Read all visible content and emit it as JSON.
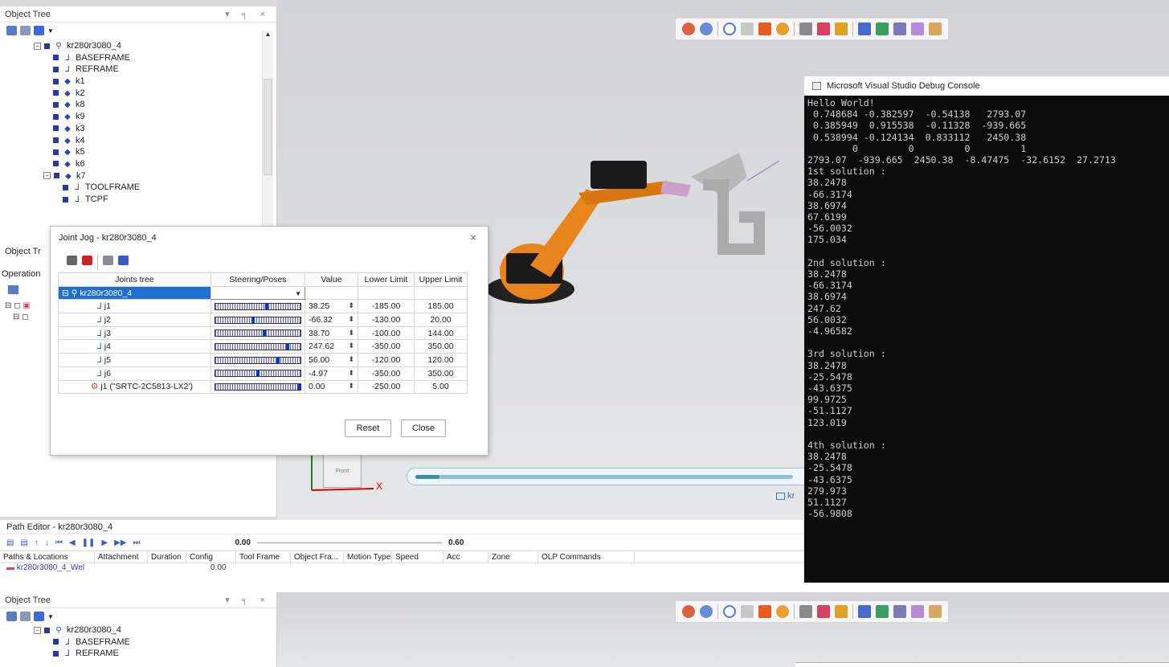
{
  "object_tree": {
    "title": "Object Tree",
    "controls": "▾ ╕ ×",
    "items": [
      {
        "label": "kr280r3080_4",
        "level": 0,
        "icon": "robot-icon"
      },
      {
        "label": "BASEFRAME",
        "level": 1,
        "icon": "frame-icon"
      },
      {
        "label": "REFRAME",
        "level": 1,
        "icon": "frame-icon"
      },
      {
        "label": "k1",
        "level": 1,
        "icon": "kinematic-icon"
      },
      {
        "label": "k2",
        "level": 1,
        "icon": "kinematic-icon"
      },
      {
        "label": "k8",
        "level": 1,
        "icon": "kinematic-icon"
      },
      {
        "label": "k9",
        "level": 1,
        "icon": "kinematic-icon"
      },
      {
        "label": "k3",
        "level": 1,
        "icon": "kinematic-icon"
      },
      {
        "label": "k4",
        "level": 1,
        "icon": "kinematic-icon"
      },
      {
        "label": "k5",
        "level": 1,
        "icon": "kinematic-icon"
      },
      {
        "label": "k6",
        "level": 1,
        "icon": "kinematic-icon"
      },
      {
        "label": "k7",
        "level": 1,
        "icon": "kinematic-icon"
      },
      {
        "label": "TOOLFRAME",
        "level": 2,
        "icon": "frame-icon"
      },
      {
        "label": "TCPF",
        "level": 2,
        "icon": "frame-icon"
      }
    ]
  },
  "side_tabs": {
    "object_tree_short": "Object Tr",
    "operation_short": "Operation"
  },
  "joint_jog": {
    "title": "Joint Jog - kr280r3080_4",
    "close": "×",
    "headers": [
      "Joints tree",
      "Steering/Poses",
      "Value",
      "Lower Limit",
      "Upper Limit"
    ],
    "root": "kr280r3080_4",
    "joints": [
      {
        "name": "j1",
        "value": "38.25",
        "lower": "-185.00",
        "upper": "185.00",
        "pos": 0.6
      },
      {
        "name": "j2",
        "value": "-66.32",
        "lower": "-130.00",
        "upper": "20.00",
        "pos": 0.43
      },
      {
        "name": "j3",
        "value": "38.70",
        "lower": "-100.00",
        "upper": "144.00",
        "pos": 0.57
      },
      {
        "name": "j4",
        "value": "247.62",
        "lower": "-350.00",
        "upper": "350.00",
        "pos": 0.85
      },
      {
        "name": "j5",
        "value": "56.00",
        "lower": "-120.00",
        "upper": "120.00",
        "pos": 0.73
      },
      {
        "name": "j6",
        "value": "-4.97",
        "lower": "-350.00",
        "upper": "350.00",
        "pos": 0.49
      },
      {
        "name": "j1 (\"SRTC-2C5813-LX2')",
        "value": "0.00",
        "lower": "-250.00",
        "upper": "5.00",
        "pos": 0.98
      }
    ],
    "reset": "Reset",
    "close_btn": "Close"
  },
  "console": {
    "title": "Microsoft Visual Studio Debug Console",
    "lines": [
      "Hello World!",
      " 0.748684 -0.382597  -0.54138   2793.07",
      " 0.385949  0.915538  -0.11328  -939.665",
      " 0.538994 -0.124134  0.833112   2450.38",
      "        0         0         0         1",
      "2793.07  -939.665  2450.38  -8.47475  -32.6152  27.2713",
      "1st solution :",
      "38.2478",
      "-66.3174",
      "38.6974",
      "67.6199",
      "-56.0032",
      "175.034",
      "",
      "2nd solution :",
      "38.2478",
      "-66.3174",
      "38.6974",
      "247.62",
      "56.0032",
      "-4.96582",
      "",
      "3rd solution :",
      "38.2478",
      "-25.5478",
      "-43.6375",
      "99.9725",
      "-51.1127",
      "123.019",
      "",
      "4th solution :",
      "38.2478",
      "-25.5478",
      "-43.6375",
      "279.973",
      "51.1127",
      "-56.9808"
    ]
  },
  "viewport": {
    "front_label": "Front",
    "axis_x": "X",
    "tooltip_label": "kr"
  },
  "path_editor": {
    "title": "Path Editor - kr280r3080_4",
    "speed_value": "0.00",
    "scale_value": "0.60",
    "columns": [
      "Paths & Locations",
      "Attachment",
      "Duration",
      "Config",
      "Tool Frame",
      "Object Fra...",
      "Motion Type",
      "Speed",
      "Acc",
      "Zone",
      "OLP Commands"
    ],
    "row": {
      "path": "kr280r3080_4_Wel",
      "duration": "0.00"
    }
  },
  "colors": {
    "accent": "#1530d0",
    "robot": "#e8841c",
    "console_bg": "#0c0c0c"
  }
}
